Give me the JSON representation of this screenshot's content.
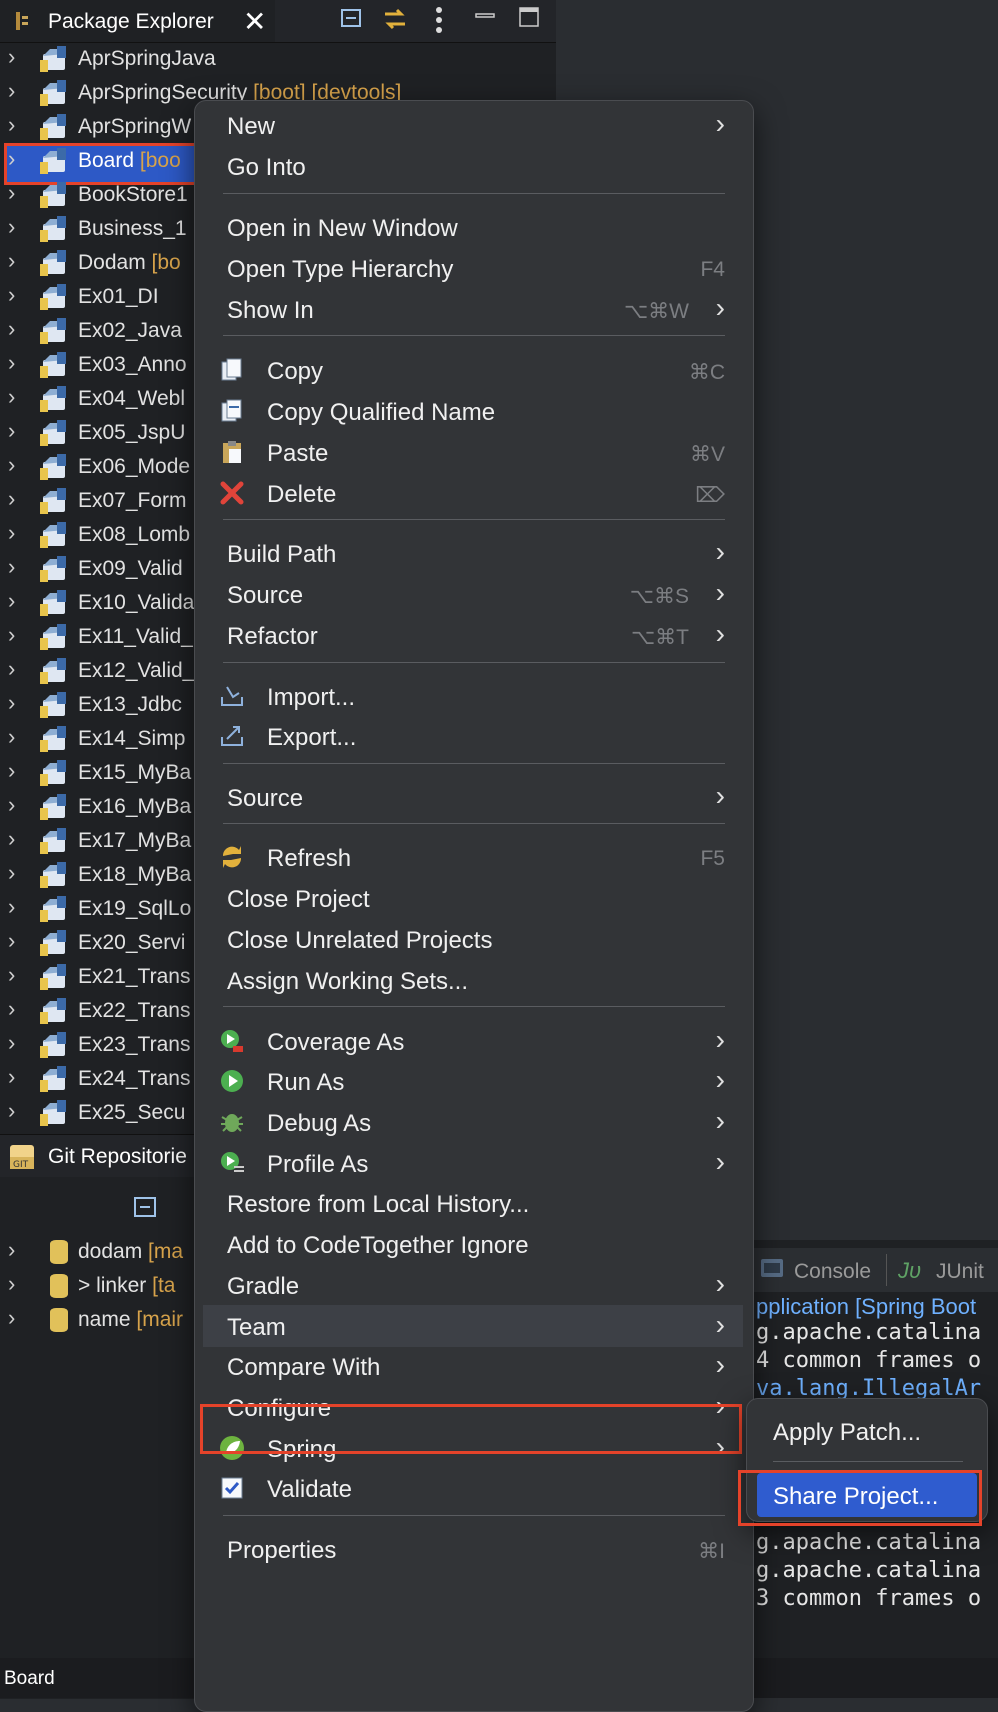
{
  "package_explorer": {
    "title": "Package Explorer",
    "close_glyph": "✕",
    "toolbar": [
      "collapse-all-icon",
      "link-with-editor-icon",
      "view-menu-icon",
      "minimize-icon",
      "maximize-icon"
    ],
    "items": [
      {
        "name": "AprSpringJava",
        "deco": ""
      },
      {
        "name": "AprSpringSecurity",
        "deco": " [boot] [devtools]"
      },
      {
        "name": "AprSpringW",
        "deco": ""
      },
      {
        "name": "Board",
        "deco": " [boo"
      },
      {
        "name": "BookStore1",
        "deco": ""
      },
      {
        "name": "Business_1",
        "deco": ""
      },
      {
        "name": "Dodam",
        "deco": " [bo"
      },
      {
        "name": "Ex01_DI",
        "deco": ""
      },
      {
        "name": "Ex02_Java",
        "deco": ""
      },
      {
        "name": "Ex03_Anno",
        "deco": ""
      },
      {
        "name": "Ex04_Webl",
        "deco": ""
      },
      {
        "name": "Ex05_JspU",
        "deco": ""
      },
      {
        "name": "Ex06_Mode",
        "deco": ""
      },
      {
        "name": "Ex07_Form",
        "deco": ""
      },
      {
        "name": "Ex08_Lomb",
        "deco": ""
      },
      {
        "name": "Ex09_Valid",
        "deco": ""
      },
      {
        "name": "Ex10_Valida",
        "deco": ""
      },
      {
        "name": "Ex11_Valid_",
        "deco": ""
      },
      {
        "name": "Ex12_Valid_",
        "deco": ""
      },
      {
        "name": "Ex13_Jdbc",
        "deco": ""
      },
      {
        "name": "Ex14_Simp",
        "deco": ""
      },
      {
        "name": "Ex15_MyBa",
        "deco": ""
      },
      {
        "name": "Ex16_MyBa",
        "deco": ""
      },
      {
        "name": "Ex17_MyBa",
        "deco": ""
      },
      {
        "name": "Ex18_MyBa",
        "deco": ""
      },
      {
        "name": "Ex19_SqlLo",
        "deco": ""
      },
      {
        "name": "Ex20_Servi",
        "deco": ""
      },
      {
        "name": "Ex21_Trans",
        "deco": ""
      },
      {
        "name": "Ex22_Trans",
        "deco": ""
      },
      {
        "name": "Ex23_Trans",
        "deco": ""
      },
      {
        "name": "Ex24_Trans",
        "deco": ""
      },
      {
        "name": "Ex25_Secu",
        "deco": ""
      }
    ]
  },
  "git_repositories": {
    "title": "Git Repositorie",
    "repos": [
      {
        "name": "dodam",
        "deco": " [ma"
      },
      {
        "name": "> linker",
        "deco": " [ta"
      },
      {
        "name": "name",
        "deco": " [mair"
      }
    ]
  },
  "console": {
    "tabs": [
      "Console",
      "JUnit"
    ],
    "launch": "pplication [Spring Boot",
    "lines": [
      {
        "text": "g.apache.catalina",
        "link": false
      },
      {
        "text": "4 common frames o",
        "link": false
      },
      {
        "text": "va.lang.IllegalAr",
        "link": true
      },
      {
        "text": "g.apache.catalina",
        "link": false
      },
      {
        "text": "g.apache.catalina",
        "link": false
      },
      {
        "text": "3 common frames o",
        "link": false
      }
    ]
  },
  "context_menu": {
    "items": [
      {
        "label": "New",
        "shortcut": "",
        "arrow": true,
        "icon": ""
      },
      {
        "label": "Go Into",
        "shortcut": "",
        "arrow": false,
        "icon": ""
      },
      {
        "label": "Open in New Window",
        "shortcut": "",
        "arrow": false,
        "icon": ""
      },
      {
        "label": "Open Type Hierarchy",
        "shortcut": "F4",
        "arrow": false,
        "icon": ""
      },
      {
        "label": "Show In",
        "shortcut": "⌥⌘W",
        "arrow": true,
        "icon": ""
      },
      {
        "label": "Copy",
        "shortcut": "⌘C",
        "arrow": false,
        "icon": "copy-icon"
      },
      {
        "label": "Copy Qualified Name",
        "shortcut": "",
        "arrow": false,
        "icon": "copy-qualified-name-icon"
      },
      {
        "label": "Paste",
        "shortcut": "⌘V",
        "arrow": false,
        "icon": "paste-icon"
      },
      {
        "label": "Delete",
        "shortcut": "⌦",
        "arrow": false,
        "icon": "delete-icon"
      },
      {
        "label": "Build Path",
        "shortcut": "",
        "arrow": true,
        "icon": ""
      },
      {
        "label": "Source",
        "shortcut": "⌥⌘S",
        "arrow": true,
        "icon": ""
      },
      {
        "label": "Refactor",
        "shortcut": "⌥⌘T",
        "arrow": true,
        "icon": ""
      },
      {
        "label": "Import...",
        "shortcut": "",
        "arrow": false,
        "icon": "import-icon"
      },
      {
        "label": "Export...",
        "shortcut": "",
        "arrow": false,
        "icon": "export-icon"
      },
      {
        "label": "Source",
        "shortcut": "",
        "arrow": true,
        "icon": ""
      },
      {
        "label": "Refresh",
        "shortcut": "F5",
        "arrow": false,
        "icon": "refresh-icon"
      },
      {
        "label": "Close Project",
        "shortcut": "",
        "arrow": false,
        "icon": ""
      },
      {
        "label": "Close Unrelated Projects",
        "shortcut": "",
        "arrow": false,
        "icon": ""
      },
      {
        "label": "Assign Working Sets...",
        "shortcut": "",
        "arrow": false,
        "icon": ""
      },
      {
        "label": "Coverage As",
        "shortcut": "",
        "arrow": true,
        "icon": "coverage-icon"
      },
      {
        "label": "Run As",
        "shortcut": "",
        "arrow": true,
        "icon": "run-icon"
      },
      {
        "label": "Debug As",
        "shortcut": "",
        "arrow": true,
        "icon": "debug-icon"
      },
      {
        "label": "Profile As",
        "shortcut": "",
        "arrow": true,
        "icon": "profile-icon"
      },
      {
        "label": "Restore from Local History...",
        "shortcut": "",
        "arrow": false,
        "icon": ""
      },
      {
        "label": "Add to CodeTogether Ignore",
        "shortcut": "",
        "arrow": false,
        "icon": ""
      },
      {
        "label": "Gradle",
        "shortcut": "",
        "arrow": true,
        "icon": ""
      },
      {
        "label": "Team",
        "shortcut": "",
        "arrow": true,
        "icon": ""
      },
      {
        "label": "Compare With",
        "shortcut": "",
        "arrow": true,
        "icon": ""
      },
      {
        "label": "Configure",
        "shortcut": "",
        "arrow": true,
        "icon": ""
      },
      {
        "label": "Spring",
        "shortcut": "",
        "arrow": true,
        "icon": "spring-icon"
      },
      {
        "label": "Validate",
        "shortcut": "",
        "arrow": false,
        "icon": "validate-checkbox-icon"
      },
      {
        "label": "Properties",
        "shortcut": "⌘I",
        "arrow": false,
        "icon": ""
      }
    ]
  },
  "team_submenu": {
    "items": [
      "Apply Patch...",
      "Share Project..."
    ]
  },
  "status_bar": {
    "text": "Board"
  },
  "colors": {
    "selection": "#2d59c6",
    "highlight_box": "#e5432a",
    "decoration": "#d7a34b"
  }
}
